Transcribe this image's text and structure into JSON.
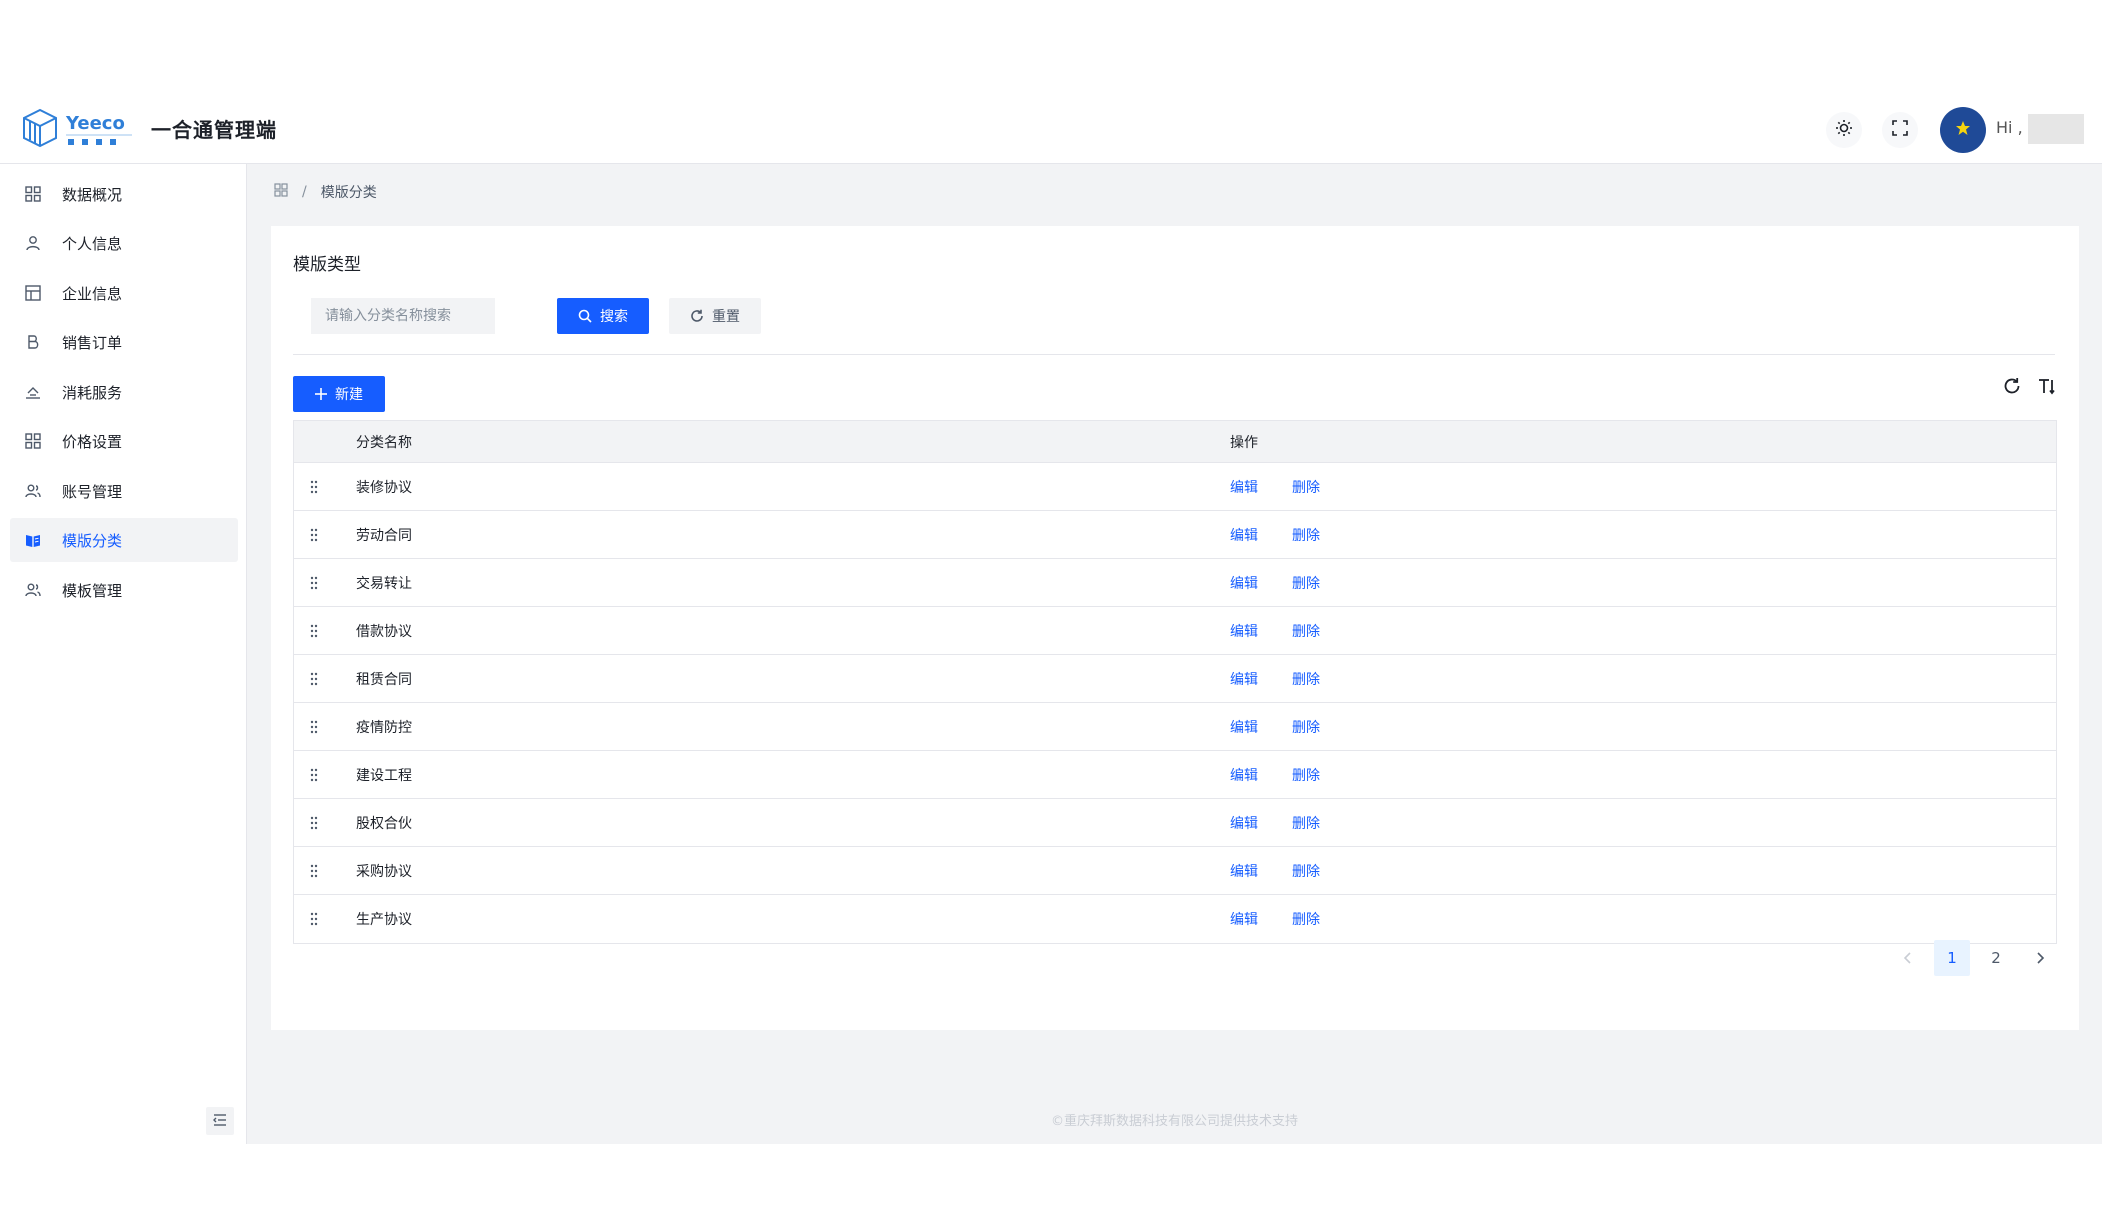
{
  "header": {
    "logo_text": "Yeeco",
    "title": "一合通管理端",
    "greeting": "Hi ,",
    "icons": [
      "sun-icon",
      "fullscreen-icon"
    ]
  },
  "sidebar": {
    "items": [
      {
        "label": "数据概况",
        "icon": "grid-icon"
      },
      {
        "label": "个人信息",
        "icon": "user-icon"
      },
      {
        "label": "企业信息",
        "icon": "layout-icon"
      },
      {
        "label": "销售订单",
        "icon": "bold-b-icon"
      },
      {
        "label": "消耗服务",
        "icon": "service-icon"
      },
      {
        "label": "价格设置",
        "icon": "grid-icon"
      },
      {
        "label": "账号管理",
        "icon": "user-group-icon"
      },
      {
        "label": "模版分类",
        "icon": "book-icon",
        "active": true
      },
      {
        "label": "模板管理",
        "icon": "user-group-icon"
      }
    ]
  },
  "breadcrumb": {
    "separator": "/",
    "current": "模版分类"
  },
  "card": {
    "title": "模版类型"
  },
  "search": {
    "placeholder": "请输入分类名称搜索",
    "search_label": "搜索",
    "reset_label": "重置"
  },
  "toolbar": {
    "new_label": "新建"
  },
  "table": {
    "columns": [
      "分类名称",
      "操作"
    ],
    "edit_label": "编辑",
    "delete_label": "删除",
    "rows": [
      "装修协议",
      "劳动合同",
      "交易转让",
      "借款协议",
      "租赁合同",
      "疫情防控",
      "建设工程",
      "股权合伙",
      "采购协议",
      "生产协议"
    ]
  },
  "pagination": {
    "pages": [
      "1",
      "2"
    ],
    "current": "1"
  },
  "footer": {
    "text": "©重庆拜斯数据科技有限公司提供技术支持"
  },
  "colors": {
    "primary": "#165dff",
    "sidebar_active_bg": "#f2f3f5",
    "avatar_bg": "#1f4a97"
  }
}
